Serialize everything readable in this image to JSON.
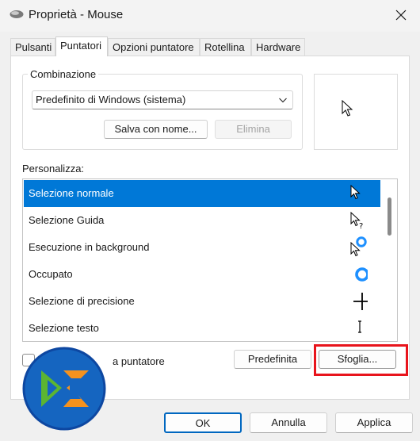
{
  "window": {
    "title": "Proprietà - Mouse"
  },
  "tabs": [
    {
      "label": "Pulsanti"
    },
    {
      "label": "Puntatori"
    },
    {
      "label": "Opzioni puntatore"
    },
    {
      "label": "Rotellina"
    },
    {
      "label": "Hardware"
    }
  ],
  "scheme": {
    "group_label": "Combinazione",
    "selected": "Predefinito di Windows (sistema)",
    "save_as_label": "Salva con nome...",
    "delete_label": "Elimina"
  },
  "customize": {
    "label": "Personalizza:",
    "items": [
      {
        "label": "Selezione normale",
        "icon": "arrow-cursor-icon",
        "selected": true
      },
      {
        "label": "Selezione Guida",
        "icon": "help-cursor-icon",
        "selected": false
      },
      {
        "label": "Esecuzione in background",
        "icon": "working-in-background-cursor-icon",
        "selected": false
      },
      {
        "label": "Occupato",
        "icon": "busy-cursor-icon",
        "selected": false
      },
      {
        "label": "Selezione di precisione",
        "icon": "precision-cursor-icon",
        "selected": false
      },
      {
        "label": "Selezione testo",
        "icon": "text-cursor-icon",
        "selected": false
      }
    ]
  },
  "shadow": {
    "label_visible_part": "a puntatore",
    "checked": false
  },
  "actions": {
    "default_label": "Predefinita",
    "browse_label": "Sfoglia..."
  },
  "footer": {
    "ok_label": "OK",
    "cancel_label": "Annulla",
    "apply_label": "Applica"
  },
  "colors": {
    "selection": "#0078d7",
    "highlight": "#e8141c",
    "busy_ring": "#1e90ff",
    "logo_blue": "#1565c0",
    "logo_orange": "#f5921e",
    "logo_green": "#5cb531"
  }
}
